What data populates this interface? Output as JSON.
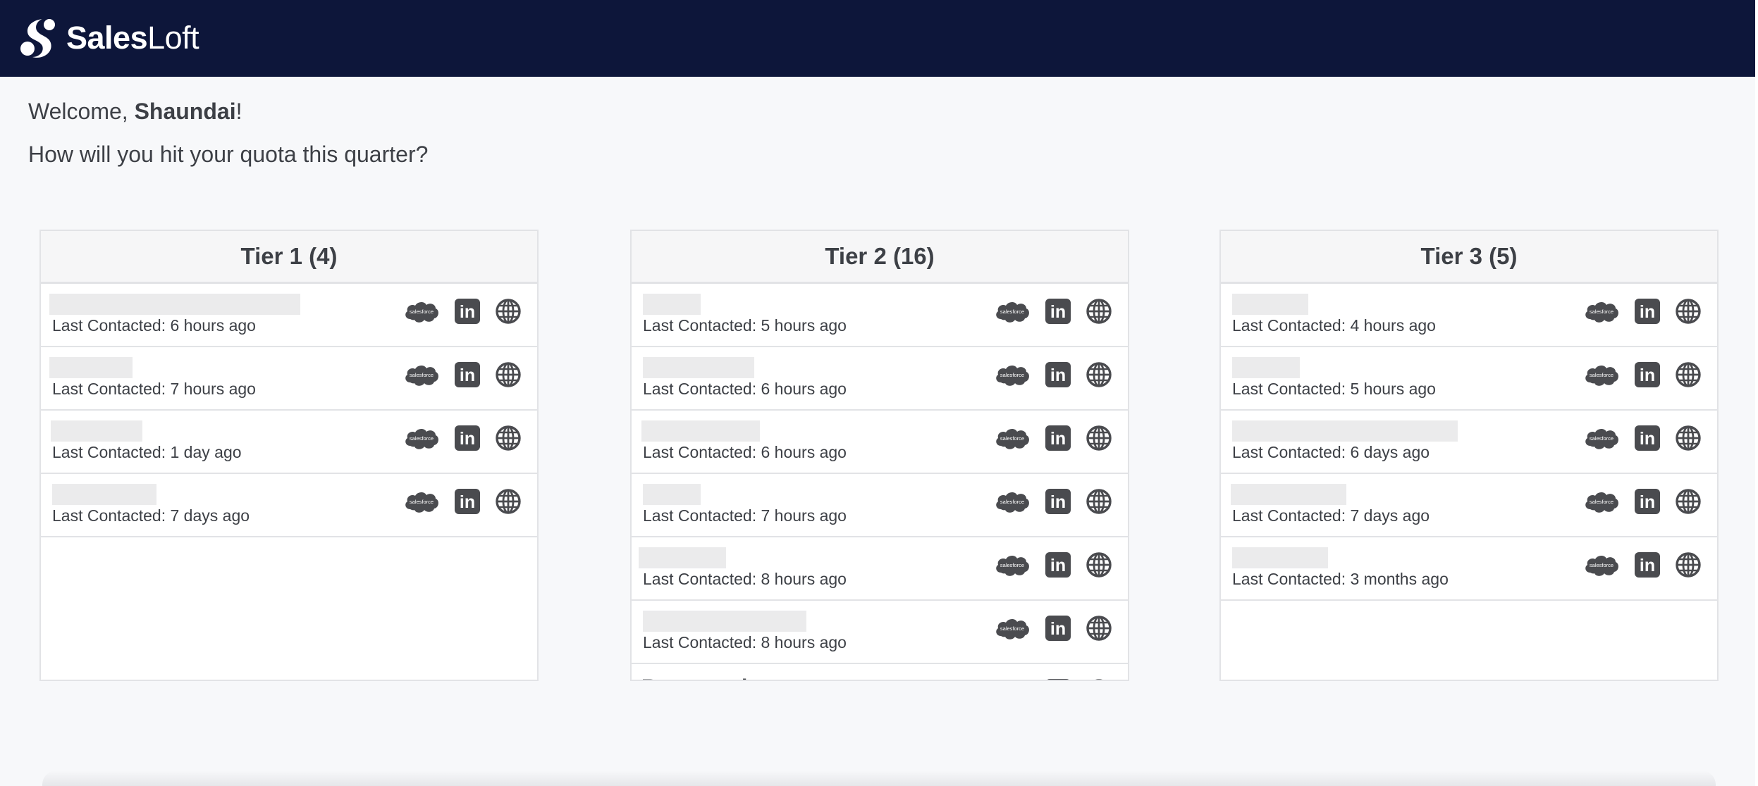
{
  "app": {
    "brand_bold": "Sales",
    "brand_light": "Loft"
  },
  "greeting": {
    "prefix": "Welcome, ",
    "user": "Shaundai",
    "suffix": "!",
    "question": "How will you hit your quota this quarter?"
  },
  "colors": {
    "header_bg": "#0d163a",
    "page_bg": "#f7f8fa",
    "icon_gray": "#4a4b4f"
  },
  "tiers": [
    {
      "title": "Tier 1 (4)",
      "rows": [
        {
          "last_contacted": "Last Contacted: 6 hours ago"
        },
        {
          "last_contacted": "Last Contacted: 7 hours ago"
        },
        {
          "last_contacted": "Last Contacted: 1 day ago"
        },
        {
          "last_contacted": "Last Contacted: 7 days ago"
        }
      ]
    },
    {
      "title": "Tier 2 (16)",
      "rows": [
        {
          "last_contacted": "Last Contacted: 5 hours ago"
        },
        {
          "last_contacted": "Last Contacted: 6 hours ago"
        },
        {
          "last_contacted": "Last Contacted: 6 hours ago"
        },
        {
          "last_contacted": "Last Contacted: 7 hours ago"
        },
        {
          "last_contacted": "Last Contacted: 8 hours ago"
        },
        {
          "last_contacted": "Last Contacted: 8 hours ago"
        }
      ],
      "partial_row_text": "Rossmanh"
    },
    {
      "title": "Tier 3 (5)",
      "rows": [
        {
          "last_contacted": "Last Contacted: 4 hours ago"
        },
        {
          "last_contacted": "Last Contacted: 5 hours ago"
        },
        {
          "last_contacted": "Last Contacted: 6 days ago"
        },
        {
          "last_contacted": "Last Contacted: 7 days ago"
        },
        {
          "last_contacted": "Last Contacted: 3 months ago"
        }
      ]
    }
  ],
  "icons": {
    "salesforce": "salesforce-icon",
    "salesforce_label": "salesforce",
    "linkedin": "linkedin-icon",
    "linkedin_label": "in",
    "website": "globe-icon"
  }
}
